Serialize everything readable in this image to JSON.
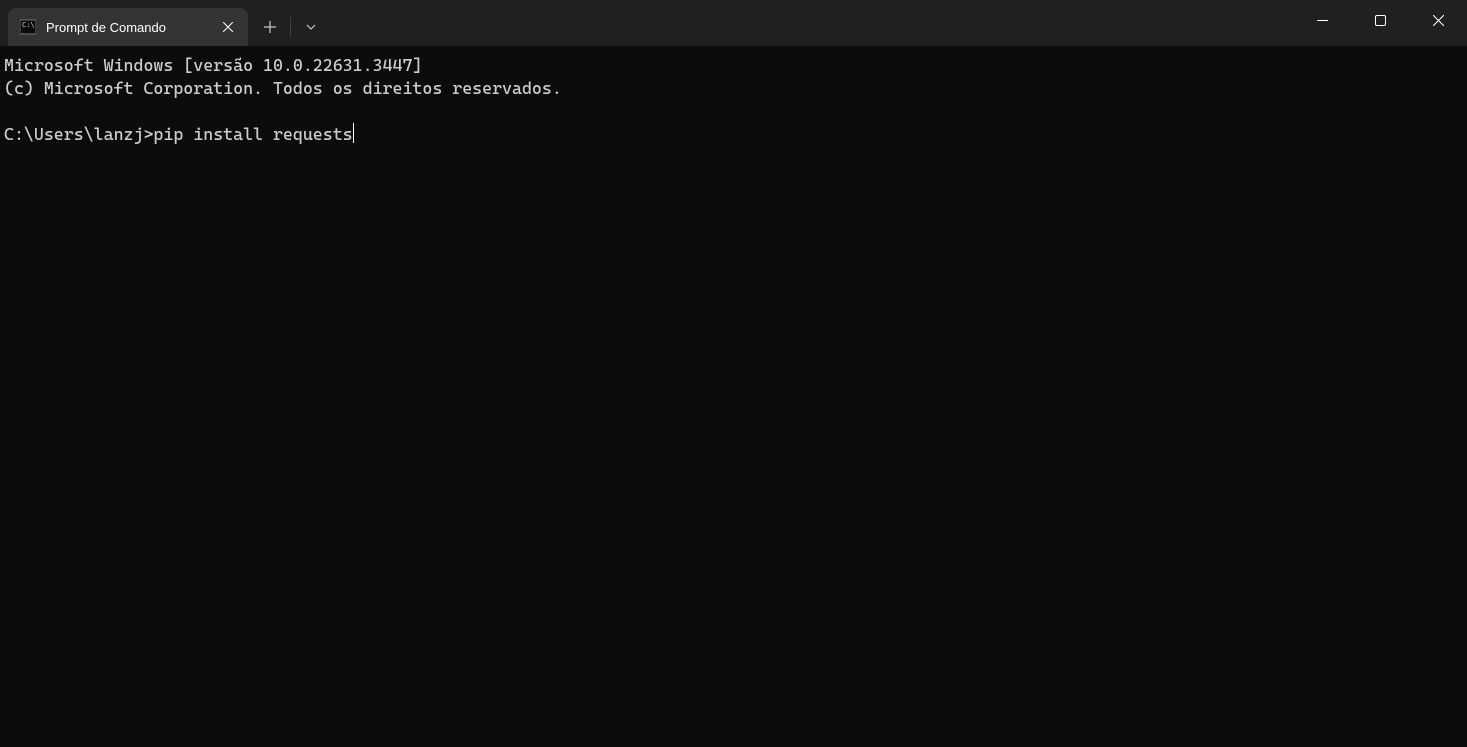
{
  "tab": {
    "title": "Prompt de Comando",
    "icon": "terminal-icon"
  },
  "terminal": {
    "line1": "Microsoft Windows [versão 10.0.22631.3447]",
    "line2": "(c) Microsoft Corporation. Todos os direitos reservados.",
    "prompt": "C:\\Users\\lanzj>",
    "command": "pip install requests"
  }
}
